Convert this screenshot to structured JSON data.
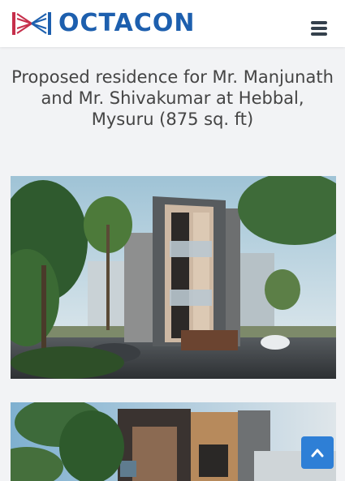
{
  "header": {
    "brand": "OCTACON",
    "logo_icon": "octacon-logo-mark",
    "menu_icon": "hamburger-menu-icon"
  },
  "project": {
    "title": "Proposed residence for Mr. Manjunath and Mr. Shivakumar at Hebbal, Mysuru (875 sq. ft)"
  },
  "gallery": {
    "images": [
      {
        "name": "rendering-residence-front-view"
      },
      {
        "name": "rendering-residence-second-view"
      }
    ]
  },
  "scroll_to_top": {
    "icon": "chevron-up-icon"
  },
  "colors": {
    "brand": "#1d5fae",
    "logo_accent": "#c62f4b",
    "scroll_button": "#2e7fd6",
    "title_text": "#444444"
  }
}
